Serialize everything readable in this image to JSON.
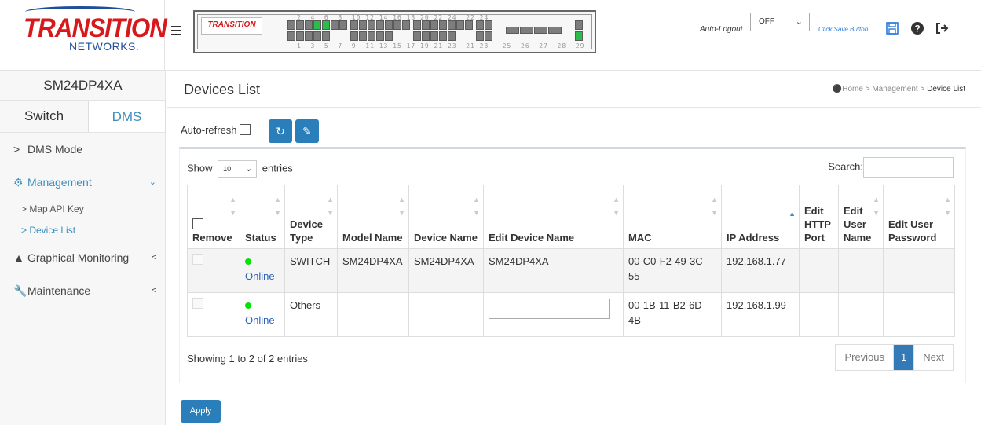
{
  "brand": {
    "logo_text": "TRANSITION",
    "logo_sub": "NETWORKS.",
    "mini_logo": "TRANSITION"
  },
  "header": {
    "port_numbers_top": "2  4  6  8  10 12 14 16 18 20 22 24  22 24",
    "port_numbers_bottom": "1  3  5  7  9  11 13 15 17 19 21 23  21 23   25  26  27  28  29",
    "auto_logout_label": "Auto-Logout",
    "auto_logout_value": "OFF",
    "save_hint": "Click Save Button"
  },
  "sidebar": {
    "model": "SM24DP4XA",
    "tabs": [
      {
        "label": "Switch"
      },
      {
        "label": "DMS"
      }
    ],
    "menu": {
      "dms_mode": "DMS Mode",
      "management": "Management",
      "map_api_key": "Map API Key",
      "device_list": "Device List",
      "graphical_monitoring": "Graphical Monitoring",
      "maintenance": "Maintenance"
    }
  },
  "page": {
    "title": "Devices List",
    "breadcrumb": {
      "home": "Home",
      "management": "Management",
      "current": "Device List",
      "sep": ">"
    },
    "auto_refresh_label": "Auto-refresh"
  },
  "table_controls": {
    "show_label": "Show",
    "entries_value": "10",
    "entries_label": "entries",
    "search_label": "Search:"
  },
  "table": {
    "headers": {
      "remove": "Remove",
      "status": "Status",
      "device_type": "Device Type",
      "model_name": "Model Name",
      "device_name": "Device Name",
      "edit_device_name": "Edit Device Name",
      "mac": "MAC",
      "ip": "IP Address",
      "edit_http_port": "Edit HTTP Port",
      "edit_user_name": "Edit User Name",
      "edit_user_password": "Edit User Password"
    },
    "rows": [
      {
        "status": "Online",
        "device_type": "SWITCH",
        "model_name": "SM24DP4XA",
        "device_name": "SM24DP4XA",
        "edit_device_name": "SM24DP4XA",
        "mac": "00-C0-F2-49-3C-55",
        "ip": "192.168.1.77"
      },
      {
        "status": "Online",
        "device_type": "Others",
        "model_name": "",
        "device_name": "",
        "edit_device_name": "",
        "mac": "00-1B-11-B2-6D-4B",
        "ip": "192.168.1.99"
      }
    ],
    "info": "Showing 1 to 2 of 2 entries"
  },
  "pagination": {
    "previous": "Previous",
    "current": "1",
    "next": "Next"
  },
  "buttons": {
    "apply": "Apply"
  },
  "colors": {
    "accent": "#3c8dbc",
    "button": "#2a7fba",
    "brand_red": "#d7191c",
    "status_online": "#00e600"
  }
}
